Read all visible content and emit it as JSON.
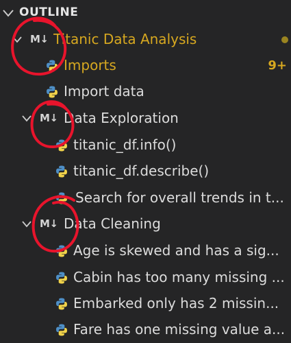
{
  "outline": {
    "title": "OUTLINE",
    "colors": {
      "background": "#252526",
      "text": "#dcdcdc",
      "accent": "#d7a820",
      "python_blue": "#4e8fc6",
      "python_yellow": "#f0d24a",
      "annotation_red": "#e8142c"
    },
    "items": [
      {
        "label": "Titanic Data Analysis",
        "icon": "markdown-icon",
        "icon_text": "M↓",
        "expanded": true,
        "modified_dot": true
      },
      {
        "label": "Imports",
        "icon": "python-icon",
        "badge": "9+"
      },
      {
        "label": "Import data",
        "icon": "python-icon"
      },
      {
        "label": "Data Exploration",
        "icon": "markdown-icon",
        "icon_text": "M↓",
        "expanded": true
      },
      {
        "label": "titanic_df.info()",
        "icon": "python-icon"
      },
      {
        "label": "titanic_df.describe()",
        "icon": "python-icon"
      },
      {
        "label": "Search for overall trends in t...",
        "icon": "python-icon"
      },
      {
        "label": "Data Cleaning",
        "icon": "markdown-icon",
        "icon_text": "M↓",
        "expanded": true
      },
      {
        "label": "Age is skewed and has a sig...",
        "icon": "python-icon"
      },
      {
        "label": "Cabin has too many missing ...",
        "icon": "python-icon"
      },
      {
        "label": "Embarked only has 2 missin...",
        "icon": "python-icon"
      },
      {
        "label": "Fare has one missing value a...",
        "icon": "python-icon"
      }
    ]
  }
}
